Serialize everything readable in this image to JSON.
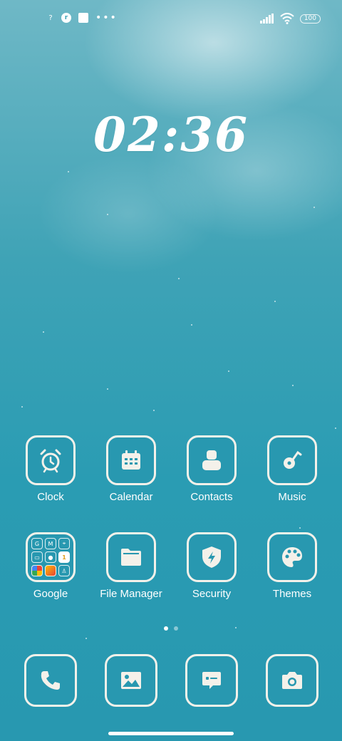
{
  "status_bar": {
    "left_icons": [
      "question-icon",
      "r-app-icon",
      "square-app-icon",
      "more-dots-icon"
    ],
    "more": "•••",
    "battery": "100",
    "right_icons": [
      "signal-icon",
      "wifi-icon",
      "battery-icon"
    ]
  },
  "clock": {
    "time": "02:36"
  },
  "apps": {
    "row1": [
      {
        "label": "Clock",
        "icon": "alarm-clock-icon"
      },
      {
        "label": "Calendar",
        "icon": "calendar-icon"
      },
      {
        "label": "Contacts",
        "icon": "contacts-icon"
      },
      {
        "label": "Music",
        "icon": "music-note-icon"
      }
    ],
    "row2": [
      {
        "label": "Google",
        "icon": "folder-icon"
      },
      {
        "label": "File Manager",
        "icon": "folder-icon"
      },
      {
        "label": "Security",
        "icon": "shield-bolt-icon"
      },
      {
        "label": "Themes",
        "icon": "palette-icon"
      }
    ]
  },
  "google_folder": {
    "mini_labels": [
      "G",
      "M",
      "",
      "",
      "",
      "1",
      "",
      "",
      ""
    ]
  },
  "dock": [
    {
      "icon": "phone-icon"
    },
    {
      "icon": "gallery-icon"
    },
    {
      "icon": "messages-icon"
    },
    {
      "icon": "camera-icon"
    }
  ],
  "page_indicator": {
    "pages": 2,
    "active": 1
  },
  "colors": {
    "tile_bg": "#2898b0",
    "tile_border": "#f4f1ea",
    "icon_fill": "#f4f1ea"
  }
}
